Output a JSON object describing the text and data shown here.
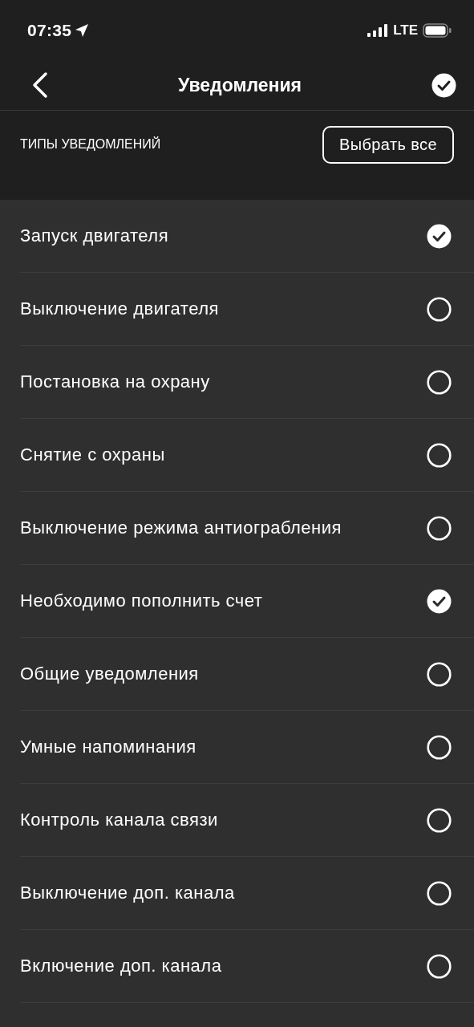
{
  "status_bar": {
    "time": "07:35",
    "network": "LTE"
  },
  "nav_bar": {
    "title": "Уведомления"
  },
  "section": {
    "title": "ТИПЫ УВЕДОМЛЕНИЙ",
    "action": "Выбрать все"
  },
  "options": [
    {
      "label": "Запуск двигателя",
      "checked": true
    },
    {
      "label": "Выключение двигателя",
      "checked": false
    },
    {
      "label": "Постановка на охрану",
      "checked": false
    },
    {
      "label": "Снятие с охраны",
      "checked": false
    },
    {
      "label": "Выключение режима антиограбления",
      "checked": false
    },
    {
      "label": "Необходимо пополнить счет",
      "checked": true
    },
    {
      "label": "Общие уведомления",
      "checked": false
    },
    {
      "label": "Умные напоминания",
      "checked": false
    },
    {
      "label": "Контроль канала связи",
      "checked": false
    },
    {
      "label": "Выключение доп. канала",
      "checked": false
    },
    {
      "label": "Включение доп. канала",
      "checked": false
    }
  ]
}
